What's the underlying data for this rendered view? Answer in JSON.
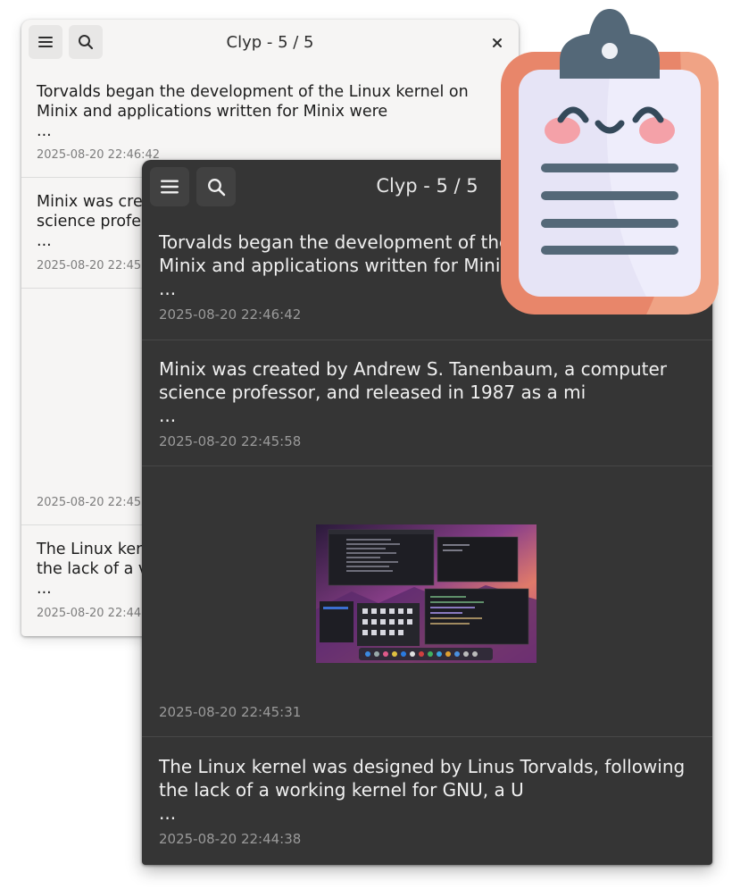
{
  "back_window": {
    "title": "Clyp - 5 / 5",
    "menu_icon": "hamburger-menu-icon",
    "search_icon": "search-icon",
    "close_icon": "close-icon",
    "items": [
      {
        "text": "Torvalds began the development of the Linux kernel on\nMinix and applications written for Minix were\n...",
        "timestamp": "2025-08-20 22:46:42"
      },
      {
        "text": "Minix was cre\nscience profe\n...",
        "timestamp": "2025-08-20 22:45:"
      },
      {
        "text": "",
        "timestamp": "2025-08-20 22:45:"
      },
      {
        "text": "The Linux ker\nthe lack of a v\n...",
        "timestamp": "2025-08-20 22:44:"
      }
    ]
  },
  "front_window": {
    "title": "Clyp - 5 / 5",
    "menu_icon": "hamburger-menu-icon",
    "search_icon": "search-icon",
    "items": [
      {
        "type": "text",
        "text": "Torvalds began the development of the\nMinix and applications written for Minix\n...",
        "timestamp": "2025-08-20 22:46:42"
      },
      {
        "type": "text",
        "text": "Minix was created by Andrew S. Tanenbaum, a computer\nscience professor, and released in 1987 as a mi\n...",
        "timestamp": "2025-08-20 22:45:58"
      },
      {
        "type": "image",
        "image_icon": "desktop-screenshot-thumbnail",
        "timestamp": "2025-08-20 22:45:31"
      },
      {
        "type": "text",
        "text": "The Linux kernel was designed by Linus Torvalds, following\nthe lack of a working kernel for GNU, a U\n...",
        "timestamp": "2025-08-20 22:44:38"
      }
    ]
  },
  "mascot": {
    "icon": "clipboard-mascot-icon"
  },
  "colors": {
    "light_bg": "#f6f5f4",
    "dark_bg": "#353535",
    "clipboard_frame": "#e8866a",
    "clipboard_clip": "#546878",
    "clipboard_paper": "#e6e4f6"
  }
}
